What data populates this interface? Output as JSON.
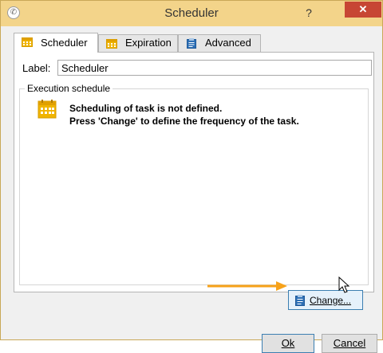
{
  "window": {
    "title": "Scheduler",
    "help_label": "?",
    "close_label": "✕"
  },
  "tabs": [
    {
      "label": "Scheduler",
      "icon": "calendar-icon",
      "active": true
    },
    {
      "label": "Expiration",
      "icon": "calendar-icon",
      "active": false
    },
    {
      "label": "Advanced",
      "icon": "clipboard-icon",
      "active": false
    }
  ],
  "form": {
    "label_caption": "Label:",
    "label_value": "Scheduler"
  },
  "schedule": {
    "group_title": "Execution schedule",
    "message_line1": "Scheduling of task is not defined.",
    "message_line2": "Press 'Change' to define the frequency of the task.",
    "change_label": "Change..."
  },
  "footer": {
    "ok_label": "Ok",
    "cancel_label": "Cancel"
  },
  "colors": {
    "titlebar": "#f3d48a",
    "accent_orange": "#f7a21a",
    "calendar_yellow": "#f0b400",
    "clipboard_blue": "#2d6fb5",
    "close_red": "#c74634"
  }
}
